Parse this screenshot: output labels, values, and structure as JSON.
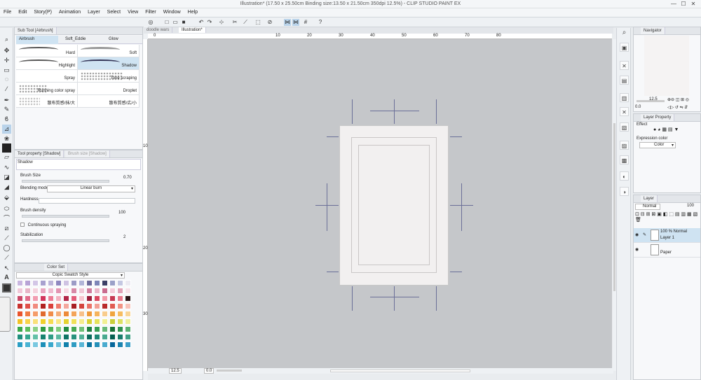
{
  "window": {
    "title": "Illustration* (17.50 x 25.50cm Binding size:13.50 x 21.50cm 350dpi 12.5%) - CLIP STUDIO PAINT EX",
    "min_label": "—",
    "max_label": "☐",
    "close_label": "✕"
  },
  "menu": [
    "File",
    "Edit",
    "Story(P)",
    "Animation",
    "Layer",
    "Select",
    "View",
    "Filter",
    "Window",
    "Help"
  ],
  "subtool": {
    "tab_label": "Sub Tool [Airbrush]",
    "tabs": [
      "Airbrush",
      "Soft_Eddie",
      "Glow"
    ],
    "brushes": [
      {
        "label": "Hard"
      },
      {
        "label": "Soft"
      },
      {
        "label": "Highlight"
      },
      {
        "label": "Shadow"
      },
      {
        "label": "Spray"
      },
      {
        "label": "Tone scraping"
      },
      {
        "label": "Running color spray"
      },
      {
        "label": "Droplet"
      },
      {
        "label": "散布質感/抹/大"
      },
      {
        "label": "散布質感/広/小"
      }
    ]
  },
  "toolprop": {
    "tab_label": "Tool property [Shadow]",
    "tab2_label": "Brush size [Shadow]",
    "preview_label": "Shadow",
    "brush_size_label": "Brush Size",
    "brush_size_value": "0.70",
    "blending_label": "Blending mode",
    "blending_value": "Linear burn",
    "hardness_label": "Hardness",
    "density_label": "Brush density",
    "density_value": "100",
    "continuous_label": "Continuous spraying",
    "stabilization_label": "Stabilization",
    "stabilization_value": "2"
  },
  "colorset": {
    "tab_label": "Color Set",
    "set_name": "Copic Swatch Style",
    "swatches": [
      [
        "#c9b7e0",
        "#b7a3d6",
        "#d3c6e6",
        "#a8a1cf",
        "#bdb6d9",
        "#8f88c0",
        "#cfc3e3",
        "#9c9cc6",
        "#b1b5d8",
        "#6e6c9c",
        "#7d86b8",
        "#3b4066",
        "#9aa0c8",
        "#c4c8e2",
        "#eceaf2"
      ],
      [
        "#f1c9d9",
        "#e8b5c7",
        "#f4d4df",
        "#e9a7c0",
        "#efbdd0",
        "#e394b1",
        "#f6dbe5",
        "#d88aa7",
        "#f0c8d6",
        "#d27d9e",
        "#eab7c9",
        "#c96c8f",
        "#f4cedb",
        "#e1a3b8",
        "#f7e1e9"
      ],
      [
        "#c94a6a",
        "#e16c8a",
        "#f19db1",
        "#d2375d",
        "#ec7f97",
        "#f3b3c1",
        "#b22748",
        "#e35d7a",
        "#f7c6d0",
        "#9d1f3b",
        "#d9485f",
        "#f29aa9",
        "#c63a54",
        "#e8788b",
        "#2b1518"
      ],
      [
        "#c7322f",
        "#e0504a",
        "#f08a7e",
        "#b0201f",
        "#d9403c",
        "#ee7a6e",
        "#f4a79d",
        "#a81f24",
        "#d4453f",
        "#ea7268",
        "#f2a096",
        "#b82a2b",
        "#e05b52",
        "#f19486",
        "#f7c2ba"
      ],
      [
        "#e8542d",
        "#f07a43",
        "#f49c6a",
        "#e06a2f",
        "#f08c4a",
        "#f5ad79",
        "#ec8a3a",
        "#f3a45a",
        "#f7c08a",
        "#ee9a3b",
        "#f5b45c",
        "#f8cc8c",
        "#f0a53e",
        "#f6bd62",
        "#f9d596"
      ],
      [
        "#f2c227",
        "#f6d34a",
        "#f9e07a",
        "#f0d02e",
        "#f5dc52",
        "#f9e885",
        "#e5d332",
        "#efe05a",
        "#f6ec8e",
        "#d8d235",
        "#e6e25c",
        "#f1ef94",
        "#c9cf3b",
        "#dce165",
        "#eef09c"
      ],
      [
        "#3aa84a",
        "#5cbc5e",
        "#8bd087",
        "#2f9a45",
        "#4fb358",
        "#7fca7e",
        "#248c42",
        "#45a856",
        "#71c079",
        "#1e7e40",
        "#3b9e55",
        "#67b878",
        "#167038",
        "#2f924f",
        "#5aaf72"
      ],
      [
        "#1f8f7c",
        "#35a78f",
        "#63c0a8",
        "#16826f",
        "#2f9c86",
        "#5cb9a0",
        "#0f7565",
        "#27917d",
        "#52b198",
        "#0a6a5c",
        "#1f8775",
        "#49a98f",
        "#055f52",
        "#187d6c",
        "#3fa086"
      ],
      [
        "#2a9ec4",
        "#4ab3d3",
        "#7ac8e0",
        "#1d8fb8",
        "#3aa8cc",
        "#6ac0dc",
        "#1281ab",
        "#2f9cc2",
        "#5ab6d6",
        "#0b739e",
        "#2590b9",
        "#4aabcf",
        "#06669a",
        "#1c84b0",
        "#3c9fc8"
      ]
    ]
  },
  "tabs": [
    "doodle wars",
    "Illustration*"
  ],
  "ruler_marks": [
    "0",
    "10",
    "20",
    "30",
    "40",
    "50",
    "60",
    "70",
    "80"
  ],
  "ruler_marks_v": [
    "10",
    "20",
    "30"
  ],
  "zoom": {
    "value": "12.5",
    "angle": "0.0"
  },
  "navigator": {
    "tab_label": "Navigator",
    "zoom_value": "12.5",
    "angle_value": "0.0"
  },
  "layer_property": {
    "tab_label": "Layer Property",
    "effect_label": "Effect",
    "expression_label": "Expression color",
    "expression_value": "Color"
  },
  "layer": {
    "tab_label": "Layer",
    "blend_mode": "Normal",
    "opacity": "100",
    "layers": [
      {
        "line1": "100 % Normal",
        "line2": "Layer 1",
        "selected": true
      },
      {
        "line1": "",
        "line2": "Paper",
        "selected": false
      }
    ]
  }
}
